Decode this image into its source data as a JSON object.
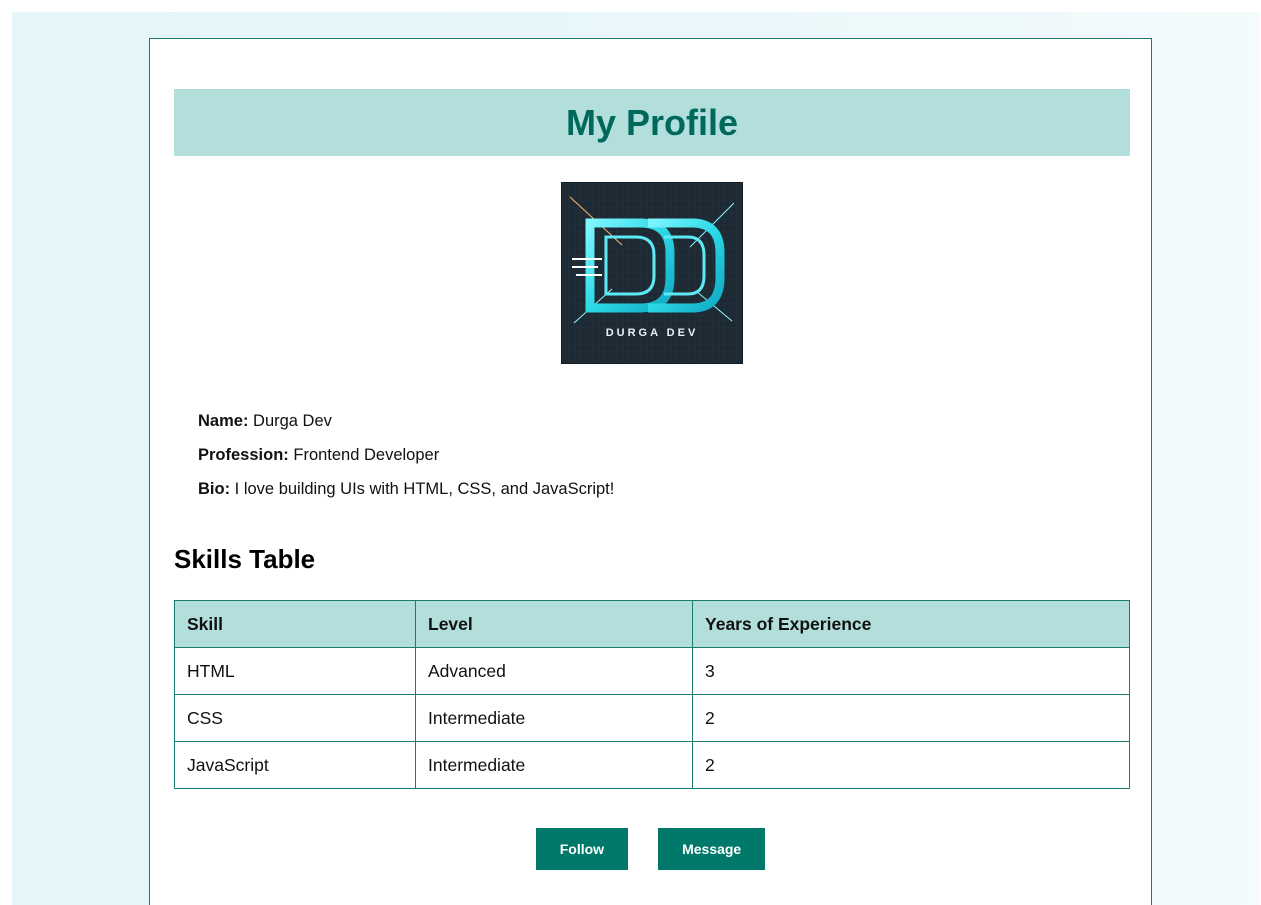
{
  "header": {
    "title": "My Profile"
  },
  "avatar": {
    "logo_text": "DURGA DEV"
  },
  "profile": {
    "name_label": "Name:",
    "name_value": "Durga Dev",
    "profession_label": "Profession:",
    "profession_value": "Frontend Developer",
    "bio_label": "Bio:",
    "bio_value": "I love building UIs with HTML, CSS, and JavaScript!"
  },
  "skills": {
    "heading": "Skills Table",
    "columns": [
      "Skill",
      "Level",
      "Years of Experience"
    ],
    "rows": [
      [
        "HTML",
        "Advanced",
        "3"
      ],
      [
        "CSS",
        "Intermediate",
        "2"
      ],
      [
        "JavaScript",
        "Intermediate",
        "2"
      ]
    ]
  },
  "actions": {
    "follow_label": "Follow",
    "message_label": "Message"
  },
  "colors": {
    "accent": "#00796b",
    "title_text": "#00695c",
    "header_bg": "#b2dfdb",
    "border": "#1c7a70",
    "page_bg": "#e4f6f9"
  }
}
